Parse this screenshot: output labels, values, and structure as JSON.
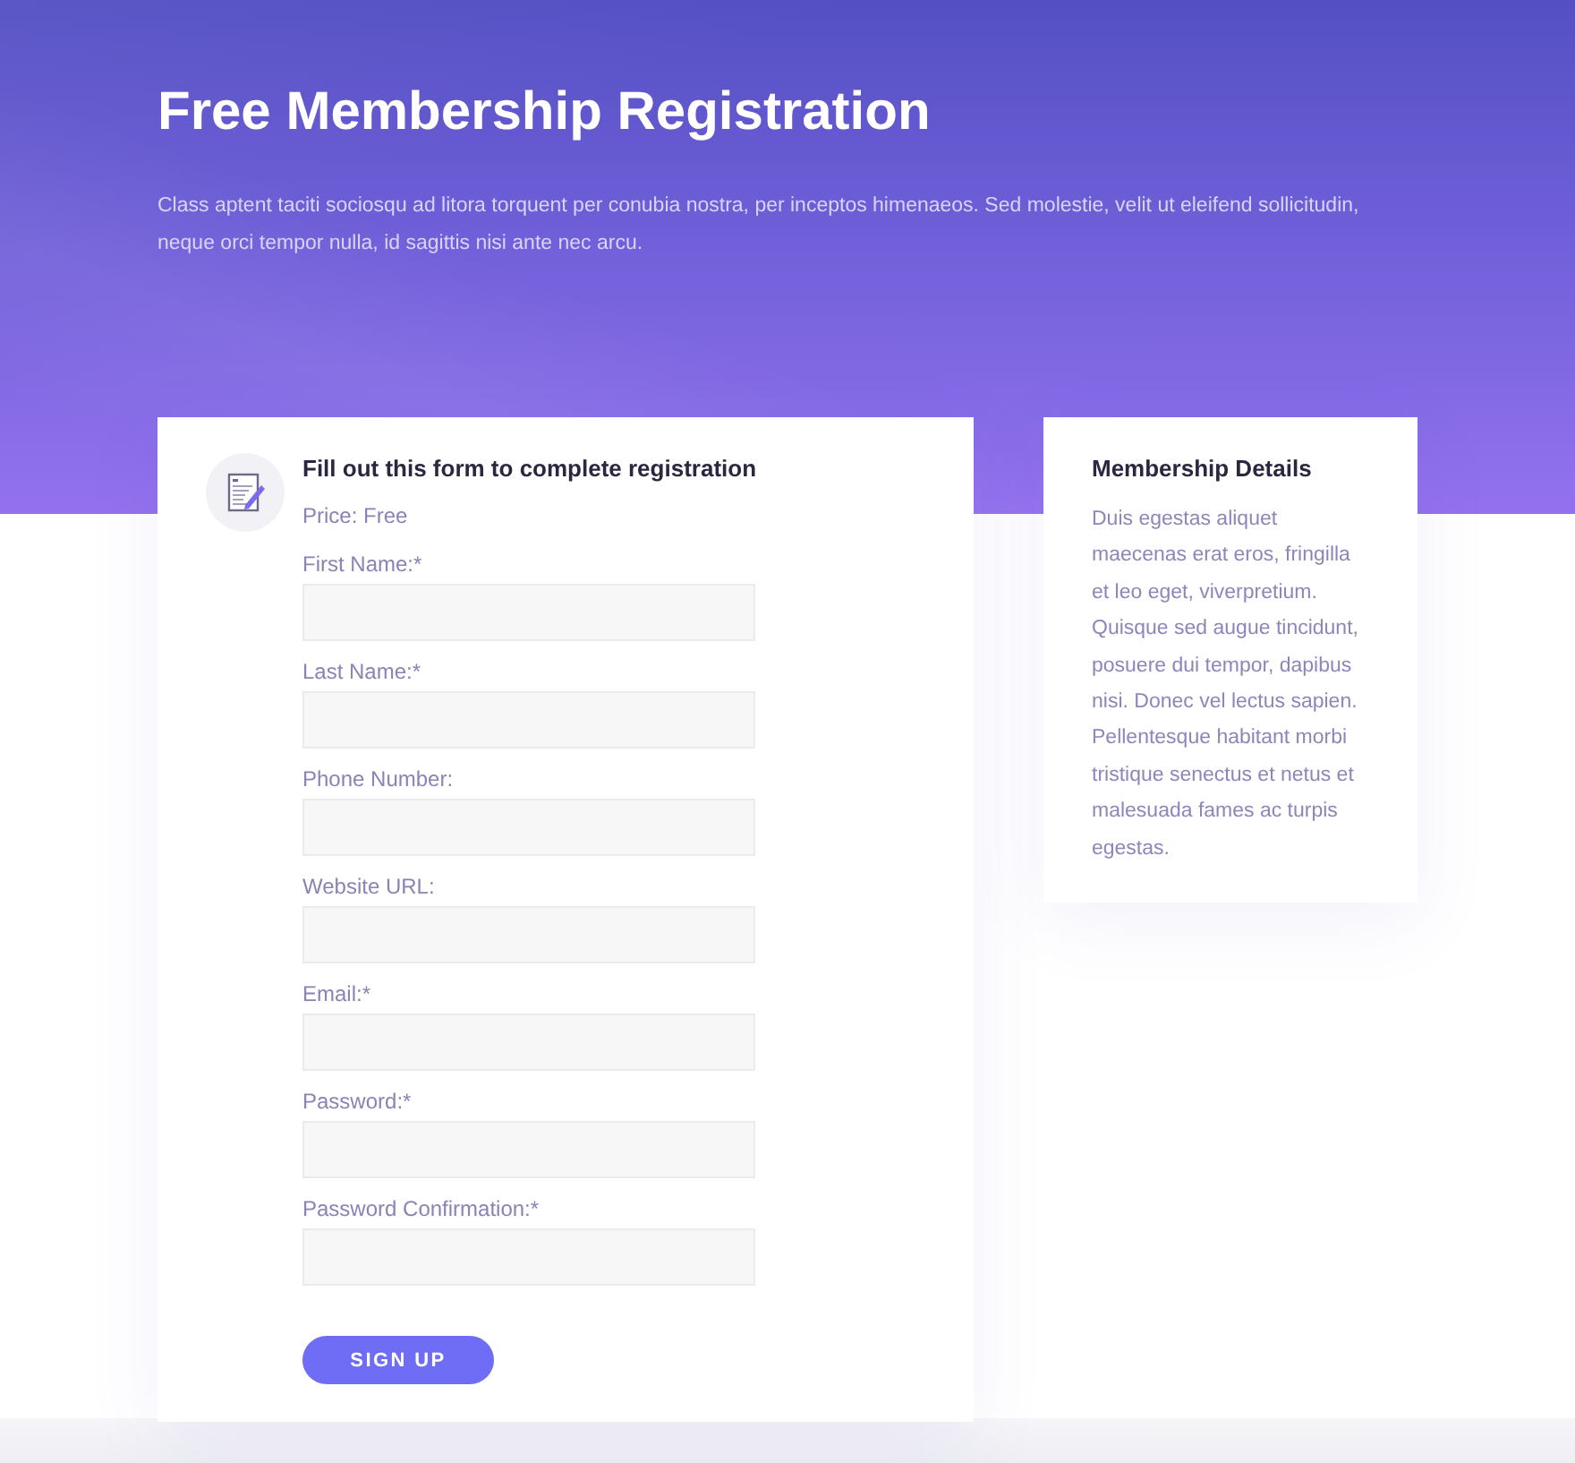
{
  "hero": {
    "title": "Free Membership Registration",
    "text": "Class aptent taciti sociosqu ad litora torquent per conubia nostra, per inceptos himenaeos. Sed molestie, velit ut eleifend sollicitudin, neque orci tempor nulla, id sagittis nisi ante nec arcu."
  },
  "form": {
    "title": "Fill out this form to complete registration",
    "price": "Price: Free",
    "fields": [
      {
        "label": "First Name:*"
      },
      {
        "label": "Last Name:*"
      },
      {
        "label": "Phone Number:"
      },
      {
        "label": "Website URL:"
      },
      {
        "label": "Email:*"
      },
      {
        "label": "Password:*"
      },
      {
        "label": "Password Confirmation:*"
      }
    ],
    "submit": "SIGN UP"
  },
  "details": {
    "title": "Membership Details",
    "text": "Duis egestas aliquet maecenas erat eros, fringilla et leo eget, viverpretium. Quisque sed augue tincidunt, posuere dui tempor, dapibus nisi. Donec vel lectus sapien. Pellentesque habitant morbi tristique senectus et netus et malesuada fames ac turpis egestas."
  }
}
